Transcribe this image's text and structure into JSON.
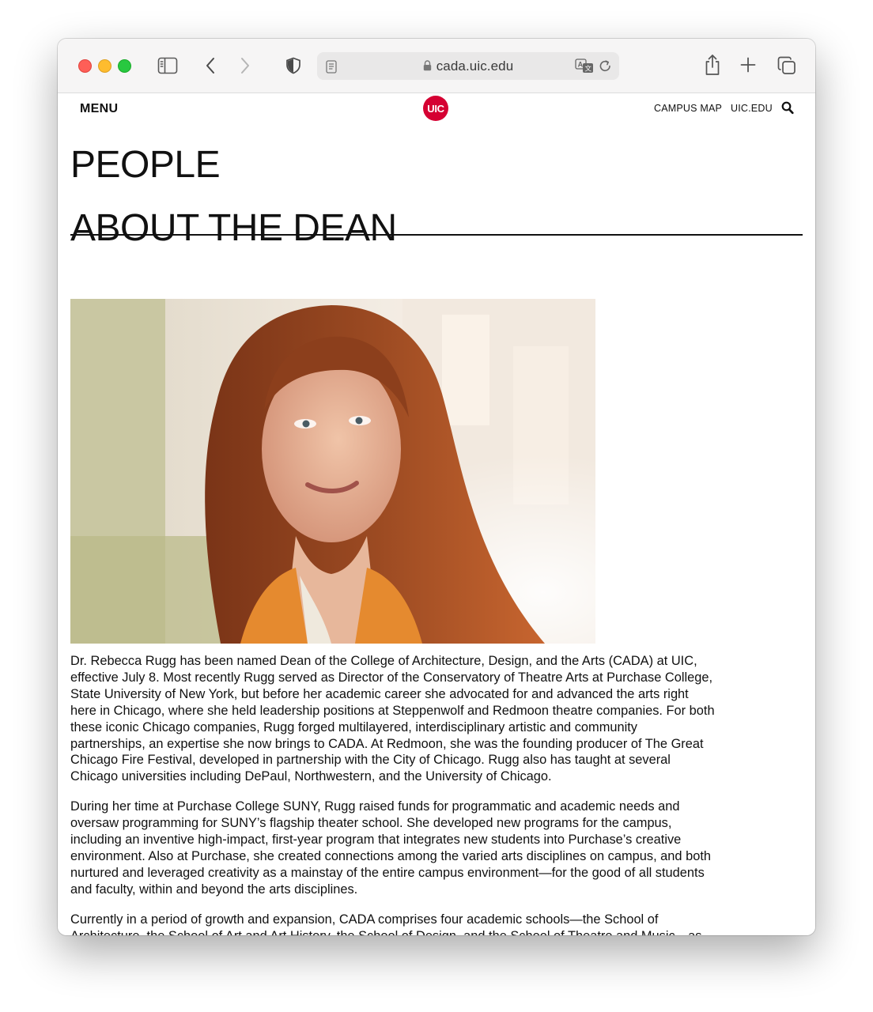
{
  "browser": {
    "url": "cada.uic.edu"
  },
  "site_header": {
    "menu_label": "MENU",
    "logo_text": "UIC",
    "links": [
      "CAMPUS MAP",
      "UIC.EDU"
    ]
  },
  "page": {
    "section_title": "PEOPLE",
    "heading": "ABOUT THE DEAN",
    "paragraphs": [
      "Dr. Rebecca Rugg has been named Dean of the College of Architecture, Design, and the Arts (CADA) at UIC, effective July 8. Most recently Rugg served as Director of the Conservatory of Theatre Arts at Purchase College, State University of New York, but before her academic career she advocated for and advanced the arts right here in Chicago, where she held leadership positions at Steppenwolf and Redmoon theatre companies. For both these iconic Chicago companies, Rugg forged multilayered, interdisciplinary artistic and community partnerships, an expertise she now brings to CADA. At Redmoon, she was the founding producer of The Great Chicago Fire Festival, developed in partnership with the City of Chicago. Rugg also has taught at several Chicago universities including DePaul, Northwestern, and the University of Chicago.",
      "During her time at Purchase College SUNY, Rugg raised funds for programmatic and academic needs and oversaw programming for SUNY’s flagship theater school. She developed new programs for the campus, including an inventive high-impact, first-year program that integrates new students into Purchase’s creative environment. Also at Purchase, she created connections among the varied arts disciplines on campus, and both nurtured and leveraged creativity as a mainstay of the entire campus environment—for the good of all students and faculty, within and beyond the arts disciplines.",
      "Currently in a period of growth and expansion, CADA comprises four academic schools—the School of Architecture, the School of Art and Art History, the School of Design, and the School of Theatre and Music—as well as Gallery 400 and the Jane Addams Hull-House Museum. As Dean of the College, Rugg will collaborate with other colleges and units, and participate in the governance of UIC’s Innovation Center."
    ]
  },
  "colors": {
    "uic_red": "#d50032",
    "text": "#111111"
  },
  "icons": [
    "sidebar-icon",
    "back-icon",
    "forward-icon",
    "privacy-shield-icon",
    "reader-icon",
    "lock-icon",
    "translate-icon",
    "reload-icon",
    "share-icon",
    "new-tab-icon",
    "tabs-overview-icon",
    "search-icon"
  ]
}
